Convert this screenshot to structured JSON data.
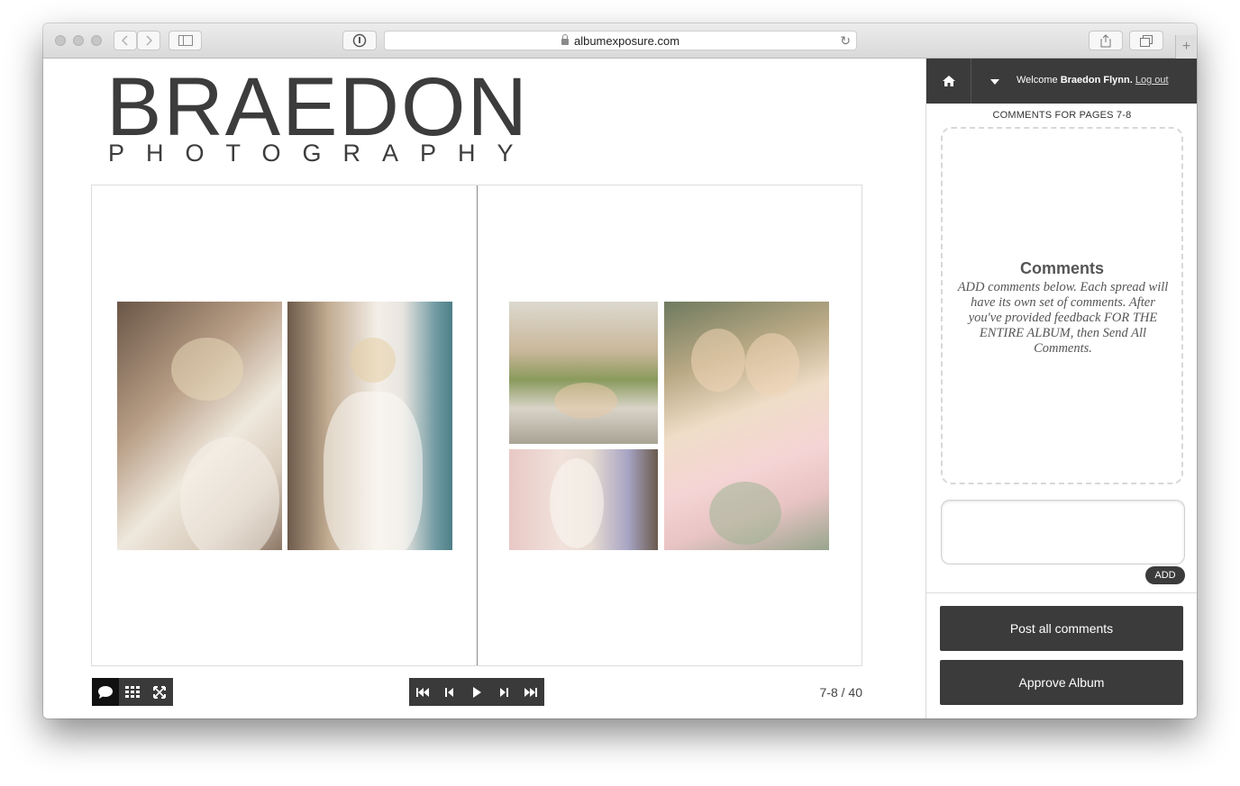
{
  "browser": {
    "url": "albumexposure.com"
  },
  "logo": {
    "main": "BRAEDON",
    "sub": "PHOTOGRAPHY"
  },
  "viewer": {
    "page_indicator": "7-8 / 40"
  },
  "sidebar": {
    "welcome_prefix": "Welcome ",
    "user_name": "Braedon Flynn.",
    "logout_label": "Log out",
    "comments_header": "COMMENTS FOR PAGES 7-8",
    "comments_title": "Comments",
    "comments_instructions": "ADD comments below. Each spread will have its own set of comments. After you've provided feedback FOR THE ENTIRE ALBUM, then Send All Comments.",
    "comment_input_value": "",
    "add_label": "ADD",
    "post_all_label": "Post all comments",
    "approve_label": "Approve Album"
  }
}
